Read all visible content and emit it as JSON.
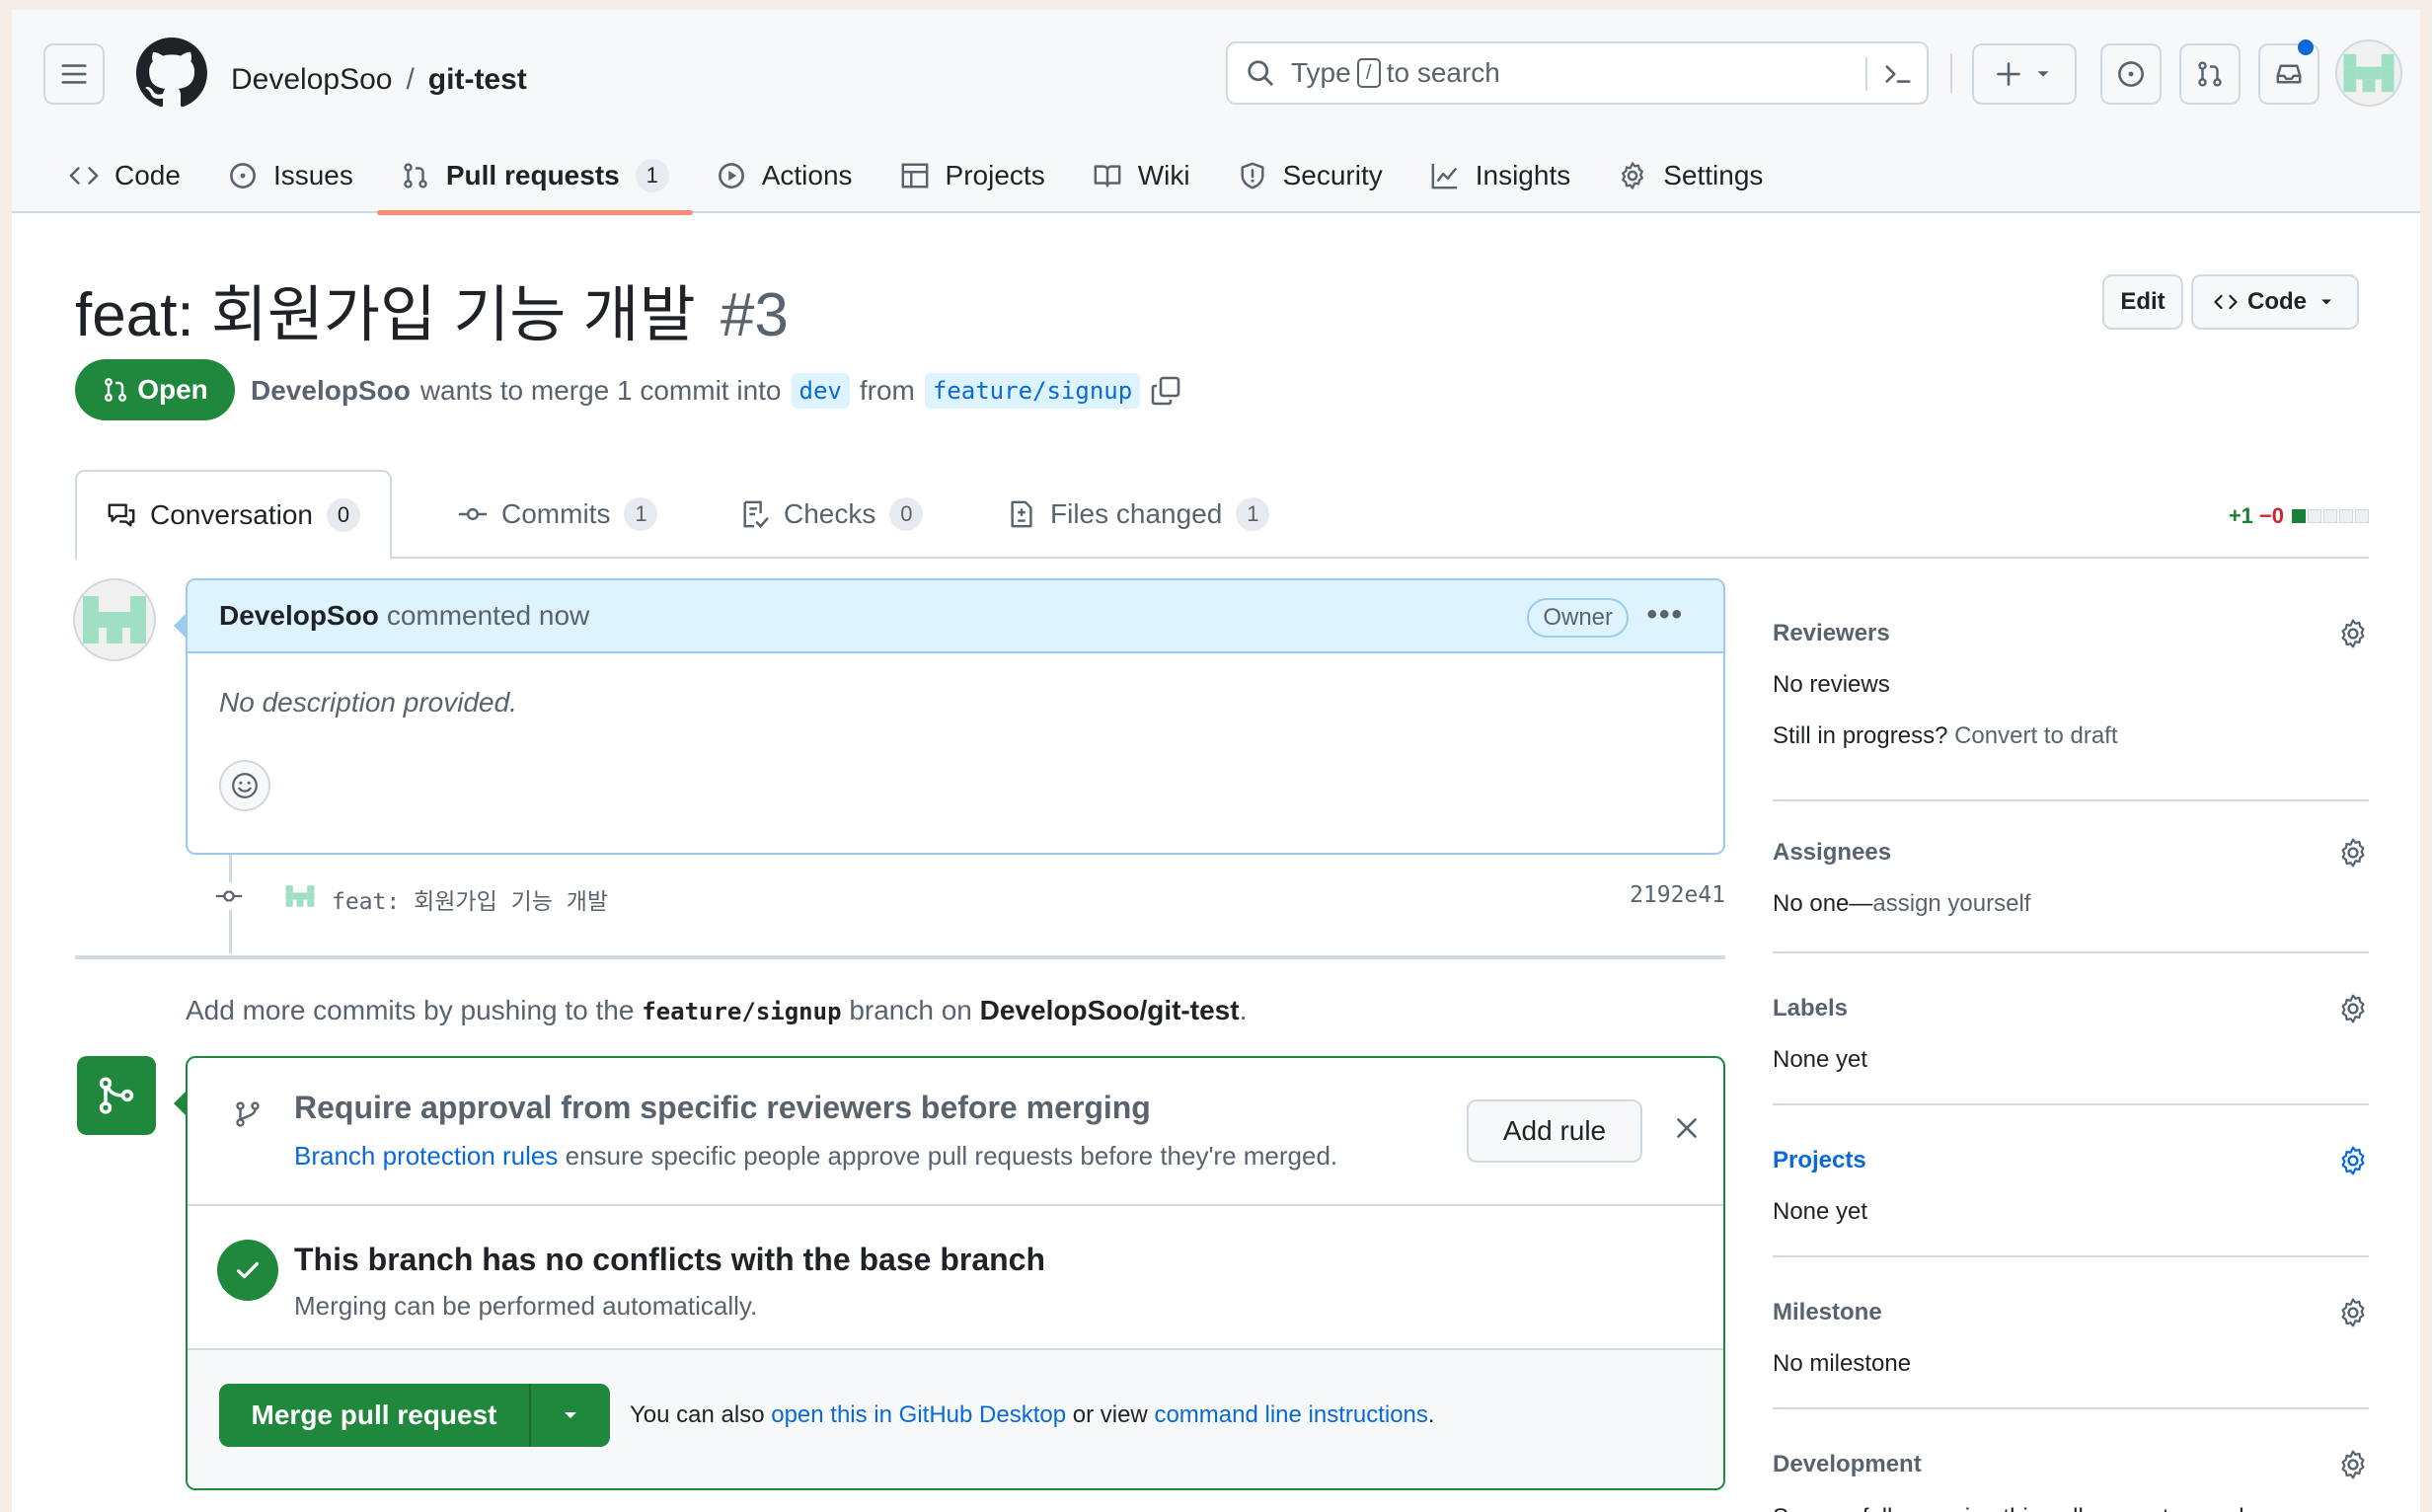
{
  "header": {
    "repo_owner": "DevelopSoo",
    "repo_separator": "/",
    "repo_name": "git-test",
    "search_placeholder_prefix": "Type",
    "search_key": "/",
    "search_placeholder_suffix": "to search"
  },
  "nav": {
    "items": [
      {
        "label": "Code",
        "icon": "code-icon"
      },
      {
        "label": "Issues",
        "icon": "issue-icon"
      },
      {
        "label": "Pull requests",
        "icon": "pull-request-icon",
        "count": "1",
        "active": true
      },
      {
        "label": "Actions",
        "icon": "play-icon"
      },
      {
        "label": "Projects",
        "icon": "table-icon"
      },
      {
        "label": "Wiki",
        "icon": "book-icon"
      },
      {
        "label": "Security",
        "icon": "shield-icon"
      },
      {
        "label": "Insights",
        "icon": "graph-icon"
      },
      {
        "label": "Settings",
        "icon": "gear-icon"
      }
    ]
  },
  "pr": {
    "title": "feat: 회원가입 기능 개발",
    "number": "#3",
    "state": "Open",
    "author": "DevelopSoo",
    "meta_text": "wants to merge 1 commit into",
    "base_branch": "dev",
    "from_text": "from",
    "head_branch": "feature/signup",
    "edit_label": "Edit",
    "code_label": "Code"
  },
  "tabs": [
    {
      "label": "Conversation",
      "count": "0",
      "icon": "comment-discussion-icon",
      "active": true
    },
    {
      "label": "Commits",
      "count": "1",
      "icon": "git-commit-icon"
    },
    {
      "label": "Checks",
      "count": "0",
      "icon": "checklist-icon"
    },
    {
      "label": "Files changed",
      "count": "1",
      "icon": "file-diff-icon"
    }
  ],
  "diffstat": {
    "additions": "+1",
    "deletions": "−0",
    "blocks_green": 1,
    "blocks_total": 5
  },
  "comment": {
    "author": "DevelopSoo",
    "action": "commented now",
    "badge": "Owner",
    "body": "No description provided."
  },
  "commit": {
    "message": "feat: 회원가입 기능 개발",
    "sha": "2192e41"
  },
  "push_note": {
    "prefix": "Add more commits by pushing to the",
    "branch": "feature/signup",
    "middle": "branch on",
    "repo": "DevelopSoo/git-test",
    "suffix": "."
  },
  "merge": {
    "rule_title": "Require approval from specific reviewers before merging",
    "rule_link": "Branch protection rules",
    "rule_text": "ensure specific people approve pull requests before they're merged.",
    "add_rule_label": "Add rule",
    "ok_title": "This branch has no conflicts with the base branch",
    "ok_sub": "Merging can be performed automatically.",
    "merge_button": "Merge pull request",
    "note_prefix": "You can also",
    "note_link1": "open this in GitHub Desktop",
    "note_middle": "or view",
    "note_link2": "command line instructions",
    "note_suffix": "."
  },
  "sidebar": {
    "reviewers": {
      "title": "Reviewers",
      "value": "No reviews",
      "extra_prefix": "Still in progress?",
      "extra_link": "Convert to draft"
    },
    "assignees": {
      "title": "Assignees",
      "value_prefix": "No one—",
      "value_link": "assign yourself"
    },
    "labels": {
      "title": "Labels",
      "value": "None yet"
    },
    "projects": {
      "title": "Projects",
      "value": "None yet"
    },
    "milestone": {
      "title": "Milestone",
      "value": "No milestone"
    },
    "development": {
      "title": "Development",
      "value": "Successfully merging this pull request may close"
    }
  },
  "colors": {
    "accent_green": "#1f883d",
    "link_blue": "#0969da",
    "nav_underline": "#fd8c73",
    "notification_dot": "#0969da"
  }
}
